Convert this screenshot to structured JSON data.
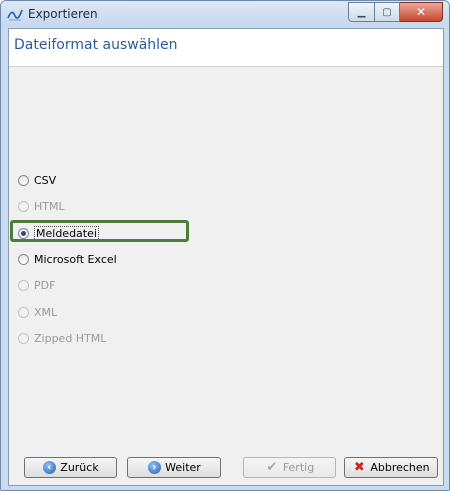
{
  "window": {
    "title": "Exportieren"
  },
  "header": {
    "title": "Dateiformat auswählen"
  },
  "formats": [
    {
      "label": "CSV",
      "enabled": true,
      "selected": false
    },
    {
      "label": "HTML",
      "enabled": false,
      "selected": false
    },
    {
      "label": "Meldedatei",
      "enabled": true,
      "selected": true
    },
    {
      "label": "Microsoft Excel",
      "enabled": true,
      "selected": false
    },
    {
      "label": "PDF",
      "enabled": false,
      "selected": false
    },
    {
      "label": "XML",
      "enabled": false,
      "selected": false
    },
    {
      "label": "Zipped HTML",
      "enabled": false,
      "selected": false
    }
  ],
  "buttons": {
    "back": "Zurück",
    "next": "Weiter",
    "finish": "Fertig",
    "cancel": "Abbrechen"
  },
  "colors": {
    "highlight": "#4e7d3a",
    "header_title": "#2c5a9e"
  }
}
